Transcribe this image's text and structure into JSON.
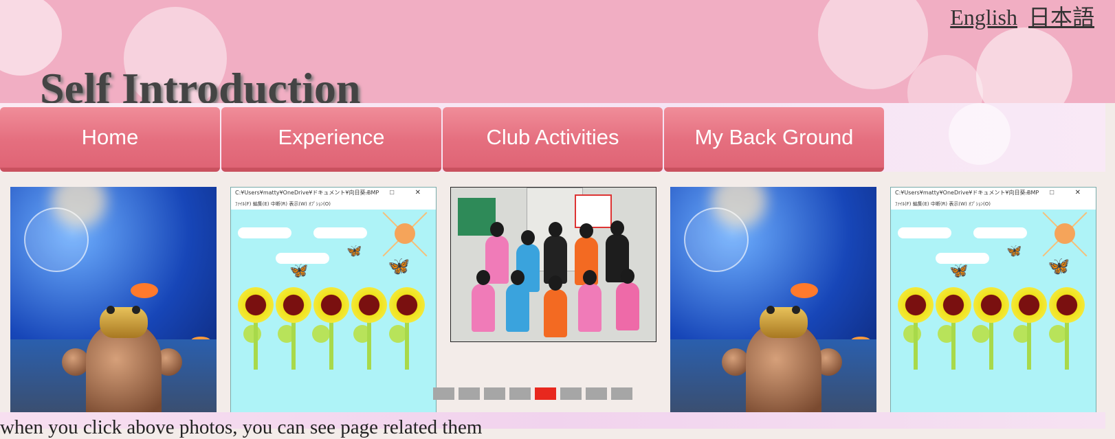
{
  "header": {
    "title": "Self Introduction",
    "languages": [
      "English",
      "日本語"
    ]
  },
  "nav": {
    "items": [
      "Home",
      "Experience",
      "Club Activities",
      "My Back Ground"
    ]
  },
  "carousel": {
    "slide_count": 8,
    "active_index": 4,
    "paint_window": {
      "title": "C:¥Users¥matty¥OneDrive¥ドキュメント¥向日葵.BMP",
      "menu": "ﾌｧｲﾙ(F)   編集(E)   中断(R)   表示(W)   ｵﾌﾟｼｮﾝ(O)",
      "window_controls": "–  □  ✕"
    }
  },
  "caption": "when you click above photos, you can see page related them",
  "colors": {
    "nav_button": "#e56f7f",
    "active_dot": "#e8281e",
    "inactive_dot": "#a6a6a6",
    "header_pink": "#f1aec3"
  }
}
